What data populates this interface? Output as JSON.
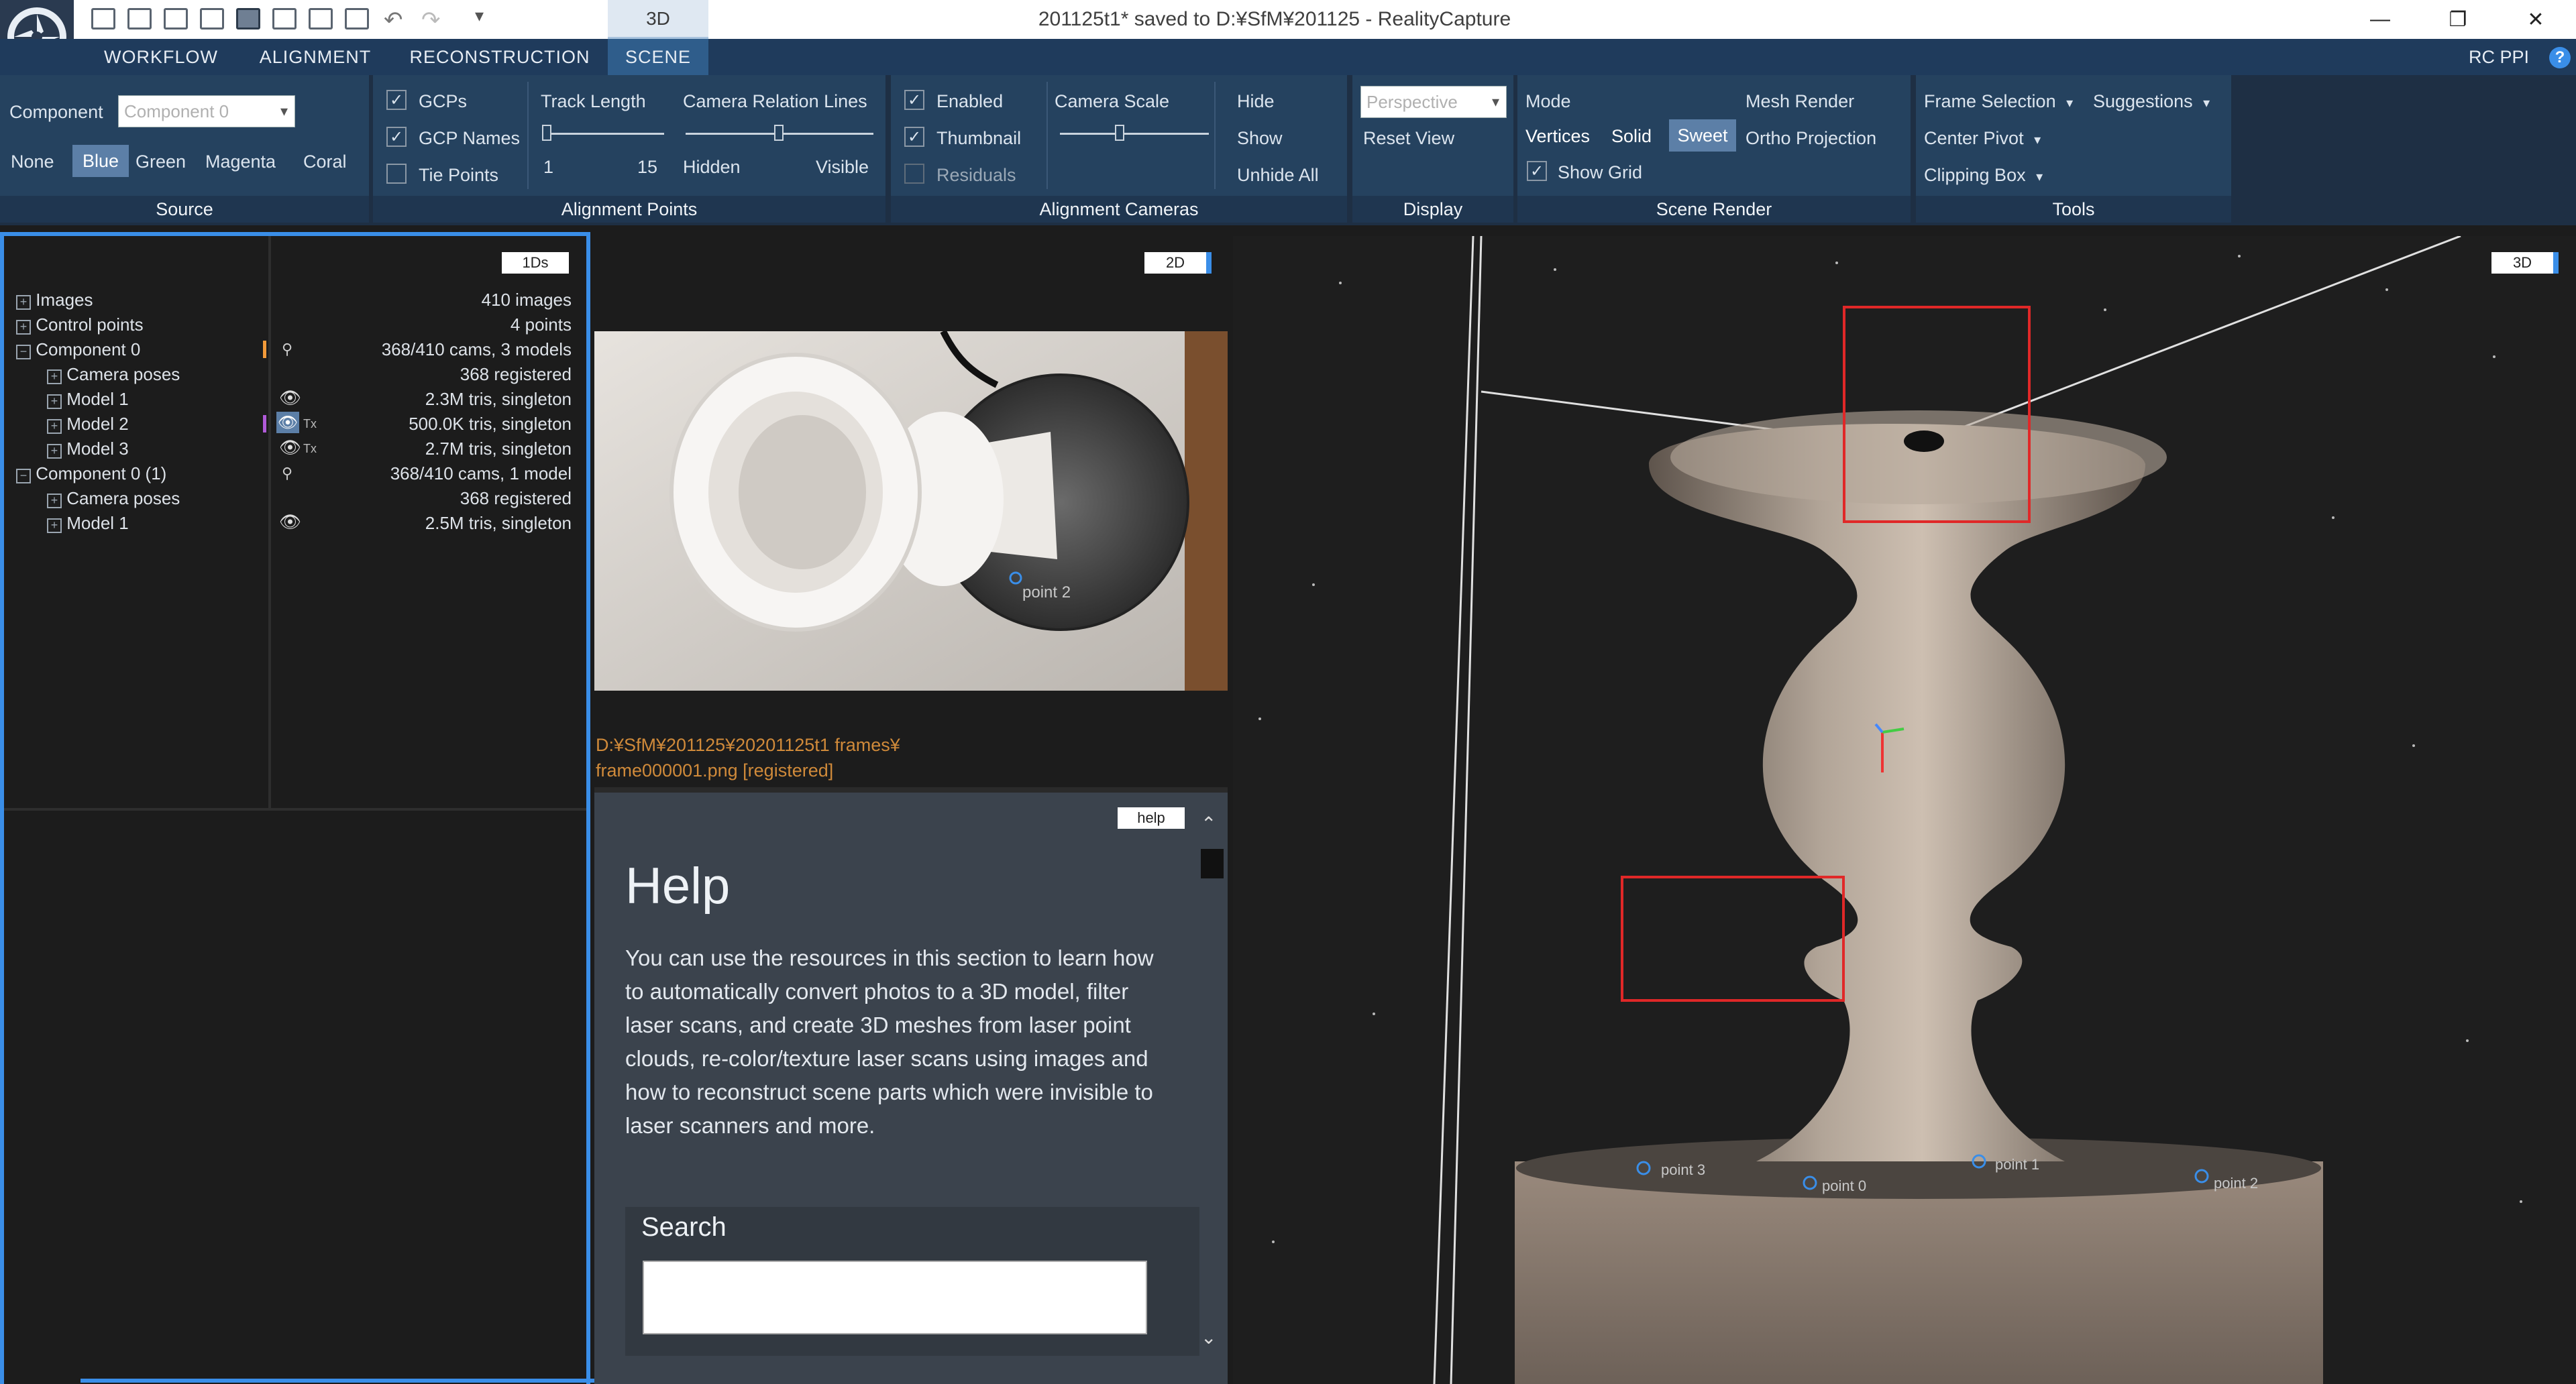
{
  "titlebar": {
    "tab_label": "3D",
    "title": "201125t1* saved to D:¥SfM¥201125 - RealityCapture",
    "minimize_glyph": "—",
    "restore_glyph": "❐",
    "close_glyph": "✕"
  },
  "menu": {
    "items": [
      "WORKFLOW",
      "ALIGNMENT",
      "RECONSTRUCTION",
      "SCENE"
    ],
    "active": "SCENE",
    "right_label": "RC PPI",
    "help_glyph": "?"
  },
  "ribbon": {
    "source": {
      "label": "Source",
      "component_label": "Component",
      "component_value": "Component 0",
      "colors": [
        "None",
        "Blue",
        "Green",
        "Magenta",
        "Coral"
      ],
      "selected_color": "Blue"
    },
    "alignment_points": {
      "label": "Alignment Points",
      "gcps": "GCPs",
      "gcp_names": "GCP Names",
      "tie_points": "Tie Points",
      "track_length": "Track Length",
      "track_min": "1",
      "track_max": "15",
      "camera_relation_lines": "Camera Relation Lines",
      "hidden": "Hidden",
      "visible": "Visible"
    },
    "alignment_cameras": {
      "label": "Alignment Cameras",
      "enabled": "Enabled",
      "thumbnail": "Thumbnail",
      "residuals": "Residuals",
      "camera_scale": "Camera Scale",
      "hide": "Hide",
      "show": "Show",
      "unhide_all": "Unhide All"
    },
    "display": {
      "label": "Display",
      "projection_value": "Perspective",
      "reset_view": "Reset View"
    },
    "scene_render": {
      "label": "Scene Render",
      "mode": "Mode",
      "mesh_render": "Mesh Render",
      "vertices": "Vertices",
      "solid": "Solid",
      "sweet": "Sweet",
      "ortho_projection": "Ortho Projection",
      "show_grid": "Show Grid"
    },
    "tools": {
      "label": "Tools",
      "frame_selection": "Frame Selection",
      "suggestions": "Suggestions",
      "center_pivot": "Center Pivot",
      "clipping_box": "Clipping Box"
    }
  },
  "tree": {
    "badge": "1Ds",
    "rows": [
      {
        "label": "Images",
        "value": "410 images"
      },
      {
        "label": "Control points",
        "value": "4 points"
      },
      {
        "label": "Component 0",
        "value": "368/410 cams, 3 models"
      },
      {
        "label": "Camera poses",
        "value": "368 registered"
      },
      {
        "label": "Model 1",
        "value": "2.3M tris, singleton"
      },
      {
        "label": "Model 2",
        "value": "500.0K tris, singleton"
      },
      {
        "label": "Model 3",
        "value": "2.7M tris, singleton"
      },
      {
        "label": "Component 0 (1)",
        "value": "368/410 cams, 1 model"
      },
      {
        "label": "Camera poses",
        "value": "368 registered"
      },
      {
        "label": "Model 1",
        "value": "2.5M tris, singleton"
      }
    ],
    "tx_label": "Tx"
  },
  "image_view": {
    "badge": "2D",
    "path_line1": "D:¥SfM¥201125¥20201125t1 frames¥",
    "path_line2": "frame000001.png [registered]",
    "point_label": "point 2"
  },
  "help": {
    "badge": "help",
    "title": "Help",
    "body": "You can use the resources in this section to learn how to automatically convert photos to a 3D model, filter laser scans, and create 3D meshes from laser point clouds, re-color/texture laser scans using images and how to reconstruct scene parts which were invisible to laser scanners and more.",
    "search_label": "Search",
    "search_value": ""
  },
  "view3d": {
    "badge": "3D",
    "point_labels": [
      "point 3",
      "point 0",
      "point 1",
      "point 2"
    ]
  }
}
